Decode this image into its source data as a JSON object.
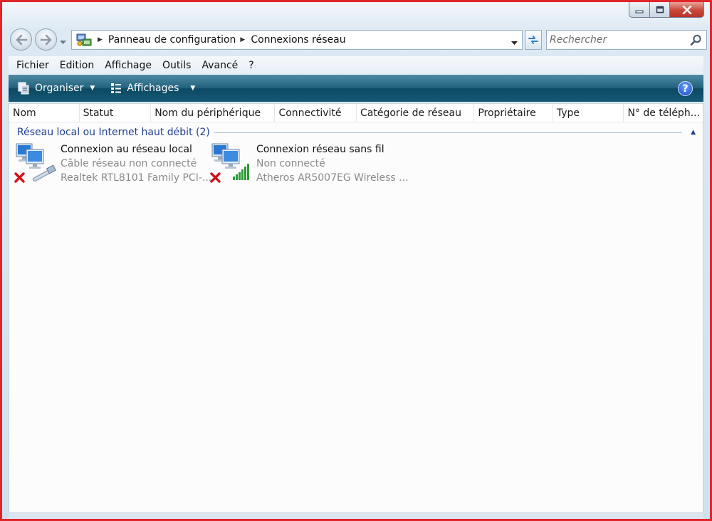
{
  "window": {
    "minimize_icon": "minimize-icon",
    "maximize_icon": "maximize-icon",
    "close_icon": "close-icon"
  },
  "nav": {
    "back_icon": "back-arrow-icon",
    "forward_icon": "forward-arrow-icon",
    "breadcrumb": [
      "Panneau de configuration",
      "Connexions réseau"
    ],
    "search_placeholder": "Rechercher"
  },
  "menu": [
    "Fichier",
    "Edition",
    "Affichage",
    "Outils",
    "Avancé",
    "?"
  ],
  "toolbar": {
    "organize_label": "Organiser",
    "views_label": "Affichages",
    "help_label": "?"
  },
  "columns": [
    "Nom",
    "Statut",
    "Nom du périphérique",
    "Connectivité",
    "Catégorie de réseau",
    "Propriétaire",
    "Type",
    "N° de téléph..."
  ],
  "group": {
    "title": "Réseau local ou Internet haut débit (2)"
  },
  "connections": [
    {
      "name": "Connexion au réseau local",
      "status": "Câble réseau non connecté",
      "device": "Realtek RTL8101 Family PCI-...",
      "icon": "lan-network-icon"
    },
    {
      "name": "Connexion réseau sans fil",
      "status": "Non connecté",
      "device": "Atheros AR5007EG Wireless ...",
      "icon": "wireless-network-icon"
    }
  ],
  "colors": {
    "frame_border": "#e0262a",
    "toolbar": "#1d5e7a",
    "group_title": "#1e3f91",
    "disconnected_x": "#d3101a",
    "signal_green": "#2f9a35"
  }
}
